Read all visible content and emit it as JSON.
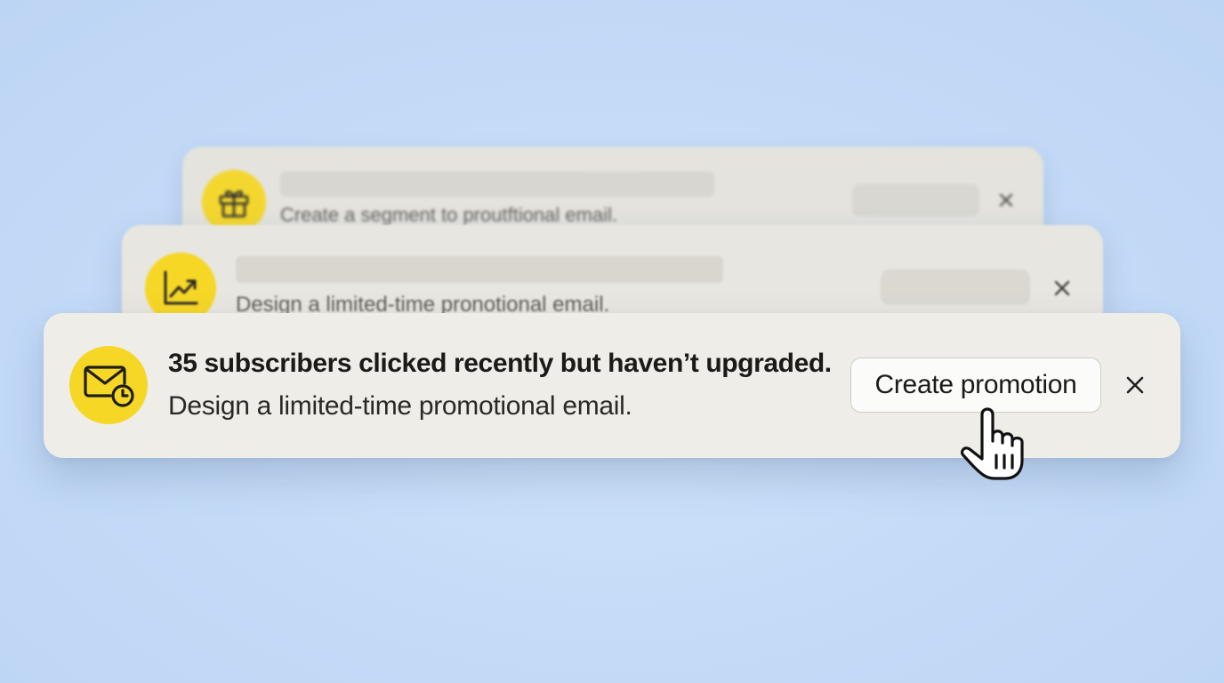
{
  "notifications": [
    {
      "id": "back",
      "icon": "gift-icon",
      "description": "Create a segment to proutftional email.",
      "close_icon": "close-icon"
    },
    {
      "id": "middle",
      "icon": "trending-up-chart-icon",
      "description": "Design a limited-time pronotional email.",
      "close_icon": "close-icon"
    },
    {
      "id": "front",
      "icon": "mail-clock-icon",
      "title": "35 subscribers clicked recently but haven’t upgraded.",
      "description": "Design a limited-time promotional email.",
      "action_label": "Create promotion",
      "close_icon": "close-icon"
    }
  ],
  "pointer_icon": "hand-pointer-icon",
  "colors": {
    "background": "#c5dcf8",
    "card": "#eeede8",
    "icon_accent": "#f6d726",
    "text": "#1b1a17"
  }
}
